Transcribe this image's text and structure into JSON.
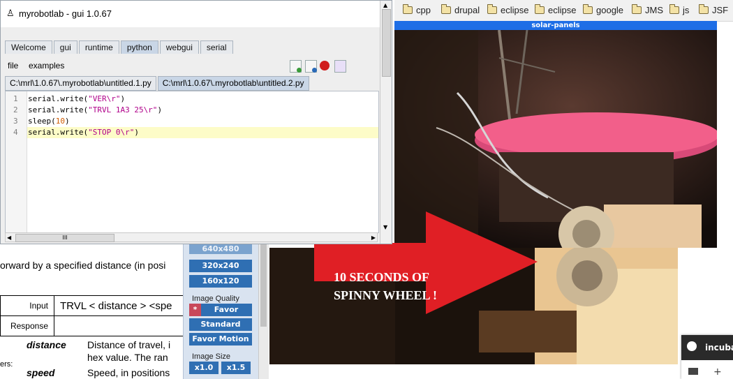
{
  "bookmarks": [
    "cpp",
    "drupal",
    "eclipse",
    "eclipse",
    "google",
    "JMS",
    "js",
    "JSF"
  ],
  "camera_title": "solar-panels",
  "overlay_text": [
    "10 SECONDS OF",
    "SPINNY WHEEL !"
  ],
  "side_panel": {
    "size_button_partial": "640x480",
    "size_buttons": [
      "320x240",
      "160x120"
    ],
    "quality_label": "Image Quality",
    "quality_buttons": [
      "Favor Clarity",
      "Standard",
      "Favor Motion"
    ],
    "image_size_label": "Image Size",
    "scale_buttons": [
      "x1.0",
      "x1.5"
    ]
  },
  "doc": {
    "intro": "orward by a specified distance (in posi",
    "input_label": "Input",
    "input_value": "TRVL < distance > <spe",
    "response_label": "Response",
    "param_section": "ers:",
    "param1": "distance",
    "param1_desc": "Distance of travel, i",
    "param1_desc2": "hex value.  The ran",
    "param2": "speed",
    "param2_desc": "Speed, in positions"
  },
  "chat": {
    "label": "incuba"
  },
  "window": {
    "title": "myrobotlab - gui 1.0.67",
    "tabs": [
      "Welcome",
      "gui",
      "runtime",
      "python",
      "webgui",
      "serial"
    ],
    "active_tab": "python",
    "menu": [
      "file",
      "examples"
    ],
    "file_tabs": [
      "C:\\mrl\\1.0.67\\.myrobotlab\\untitled.1.py",
      "C:\\mrl\\1.0.67\\.myrobotlab\\untitled.2.py"
    ],
    "active_file": 1,
    "code": [
      {
        "num": "1",
        "fn": "serial.write(",
        "arg": "\"VER\\r\"",
        "end": ")"
      },
      {
        "num": "2",
        "fn": "serial.write(",
        "arg": "\"TRVL 1A3 25\\r\"",
        "end": ")"
      },
      {
        "num": "3",
        "fn": "sleep(",
        "arg": "10",
        "end": ")"
      },
      {
        "num": "4",
        "fn": "serial.write(",
        "arg": "\"STOP 0\\r\"",
        "end": ")"
      }
    ],
    "hscroll_thumb": "III",
    "colors": {
      "accent": "#1e6ee6",
      "button": "#2f6fb3",
      "highlight": "#fdfcc8"
    }
  }
}
